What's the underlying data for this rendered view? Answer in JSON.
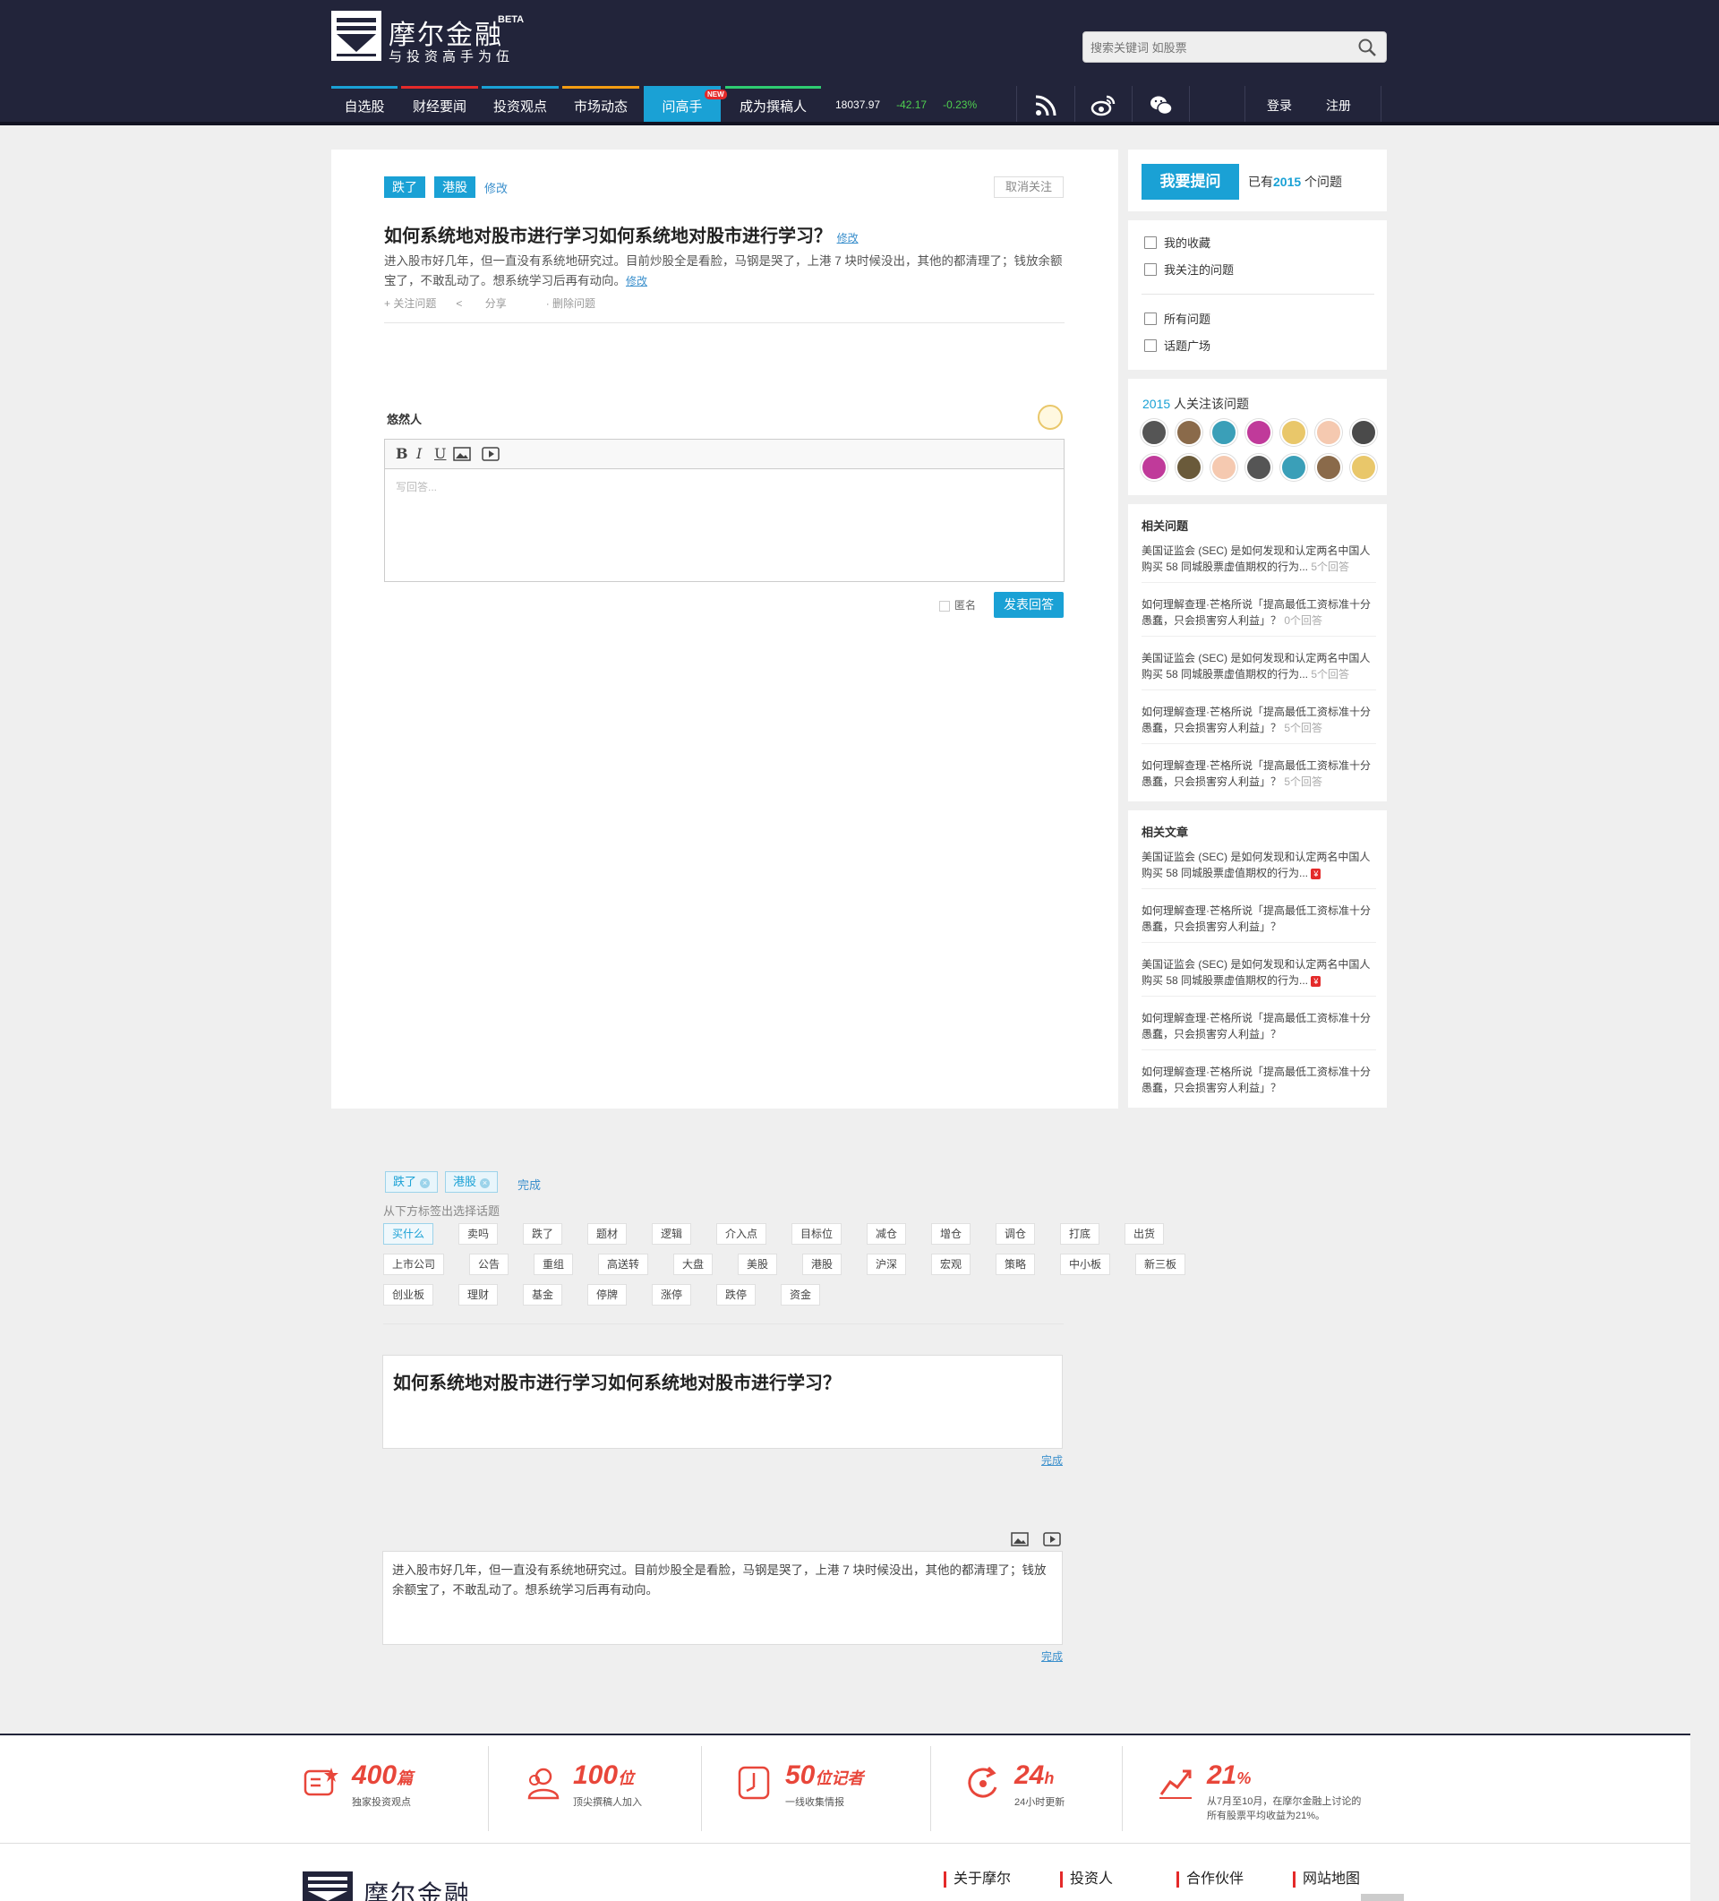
{
  "header": {
    "logo_name": "摩尔金融",
    "logo_beta": "BETA",
    "logo_slogan": "与投资高手为伍",
    "search_placeholder": "搜索关键词 如股票",
    "nav": [
      "自选股",
      "财经要闻",
      "投资观点",
      "市场动态",
      "问高手",
      "成为撰稿人"
    ],
    "nav_border_colors": [
      "#1aa1d5",
      "#e42a2a",
      "#1aa1d5",
      "#f39c12",
      "#1aa1d5",
      "#2ecc71"
    ],
    "nav_active_index": 4,
    "nav_new_badge": "NEW",
    "ticker": {
      "index": "18037.97",
      "change": "-42.17",
      "percent": "-0.23%"
    },
    "login": "登录",
    "register": "注册"
  },
  "question": {
    "tags": [
      "跌了",
      "港股"
    ],
    "edit_tags": "修改",
    "unfollow": "取消关注",
    "title": "如何系统地对股市进行学习如何系统地对股市进行学习？",
    "edit_title": "修改",
    "description": "进入股市好几年，但一直没有系统地研究过。目前炒股全是看脸，马钢是哭了，上港 7 块时候没出，其他的都清理了；钱放余额宝了，不敢乱动了。想系统学习后再有动向。",
    "edit_desc": "修改",
    "actions": [
      "+ 关注问题",
      "分享",
      "· 删除问题"
    ]
  },
  "answer": {
    "username": "悠然人",
    "placeholder": "写回答...",
    "anonymous": "匿名",
    "submit": "发表回答"
  },
  "sidebar": {
    "ask_button": "我要提问",
    "ask_count_prefix": "已有",
    "ask_count": "2015",
    "ask_count_suffix": "个问题",
    "links": [
      "我的收藏",
      "我关注的问题",
      "所有问题",
      "话题广场"
    ],
    "followers_count": "2015",
    "followers_label": "人关注该问题",
    "avatar_colors": [
      "#555",
      "#8a6a4a",
      "#3a9fb8",
      "#c03a9a",
      "#e9c76a",
      "#f5c9b0",
      "#4a4a4a",
      "#c03a9a",
      "#6a5a3a",
      "#f5c9b0",
      "#555",
      "#3a9fb8",
      "#8a6a4a",
      "#e9c76a"
    ],
    "related_questions_title": "相关问题",
    "related_questions": [
      {
        "text": "美国证监会 (SEC) 是如何发现和认定两名中国人购买 58 同城股票虚值期权的行为...",
        "count": "5个回答"
      },
      {
        "text": "如何理解查理·芒格所说「提高最低工资标准十分愚蠢，只会损害穷人利益」？",
        "count": "0个回答"
      },
      {
        "text": "美国证监会 (SEC) 是如何发现和认定两名中国人购买 58 同城股票虚值期权的行为...",
        "count": "5个回答"
      },
      {
        "text": "如何理解查理·芒格所说「提高最低工资标准十分愚蠢，只会损害穷人利益」？",
        "count": "5个回答"
      },
      {
        "text": "如何理解查理·芒格所说「提高最低工资标准十分愚蠢，只会损害穷人利益」？",
        "count": "5个回答"
      }
    ],
    "related_articles_title": "相关文章",
    "related_articles": [
      {
        "text": "美国证监会 (SEC) 是如何发现和认定两名中国人购买 58 同城股票虚值期权的行为...",
        "mark": "¥"
      },
      {
        "text": "如何理解查理·芒格所说「提高最低工资标准十分愚蠢，只会损害穷人利益」？",
        "mark": ""
      },
      {
        "text": "美国证监会 (SEC) 是如何发现和认定两名中国人购买 58 同城股票虚值期权的行为...",
        "mark": "¥"
      },
      {
        "text": "如何理解查理·芒格所说「提高最低工资标准十分愚蠢，只会损害穷人利益」？",
        "mark": ""
      },
      {
        "text": "如何理解查理·芒格所说「提高最低工资标准十分愚蠢，只会损害穷人利益」？",
        "mark": ""
      }
    ]
  },
  "edit": {
    "tags": [
      "跌了",
      "港股"
    ],
    "done": "完成",
    "hint": "从下方标签出选择话题",
    "candidate_rows": [
      [
        "买什么",
        "卖吗",
        "跌了",
        "题材",
        "逻辑",
        "介入点",
        "目标位",
        "减仓",
        "增仓",
        "调仓",
        "打底",
        "出货"
      ],
      [
        "上市公司",
        "公告",
        "重组",
        "高送转",
        "大盘",
        "美股",
        "港股",
        "沪深",
        "宏观",
        "策略",
        "中小板",
        "新三板"
      ],
      [
        "创业板",
        "理财",
        "基金",
        "停牌",
        "涨停",
        "跌停",
        "资金"
      ]
    ],
    "title_value": "如何系统地对股市进行学习如何系统地对股市进行学习？",
    "desc_value": "进入股市好几年，但一直没有系统地研究过。目前炒股全是看脸，马钢是哭了，上港 7 块时候没出，其他的都清理了；钱放余额宝了，不敢乱动了。想系统学习后再有动向。"
  },
  "footer": {
    "stats": [
      {
        "num": "400",
        "unit": "篇",
        "label": "独家投资观点",
        "icon": "article-star-icon"
      },
      {
        "num": "100",
        "unit": "位",
        "label": "顶尖撰稿人加入",
        "icon": "users-icon"
      },
      {
        "num": "50",
        "unit": "位记者",
        "label": "一线收集情报",
        "icon": "clock-icon"
      },
      {
        "num": "24",
        "unit": "h",
        "label": "24小时更新",
        "icon": "refresh-icon"
      },
      {
        "num": "21",
        "unit": "%",
        "label": "从7月至10月，在摩尔金融上讨论的所有股票平均收益为21%。",
        "icon": "trend-icon"
      }
    ],
    "logo_name": "摩尔金融",
    "links": [
      "关于摩尔",
      "投资人",
      "合作伙伴",
      "网站地图"
    ]
  }
}
